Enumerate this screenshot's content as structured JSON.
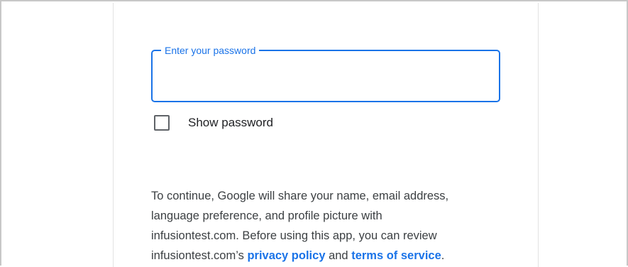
{
  "password_field": {
    "label": "Enter your password",
    "value": ""
  },
  "show_password": {
    "label": "Show password",
    "checked": false
  },
  "disclaimer": {
    "line1": "To continue, Google will share your name, email address,",
    "line2": "language preference, and profile picture with",
    "line3": "infusiontest.com. Before using this app, you can review",
    "line4_prefix": "infusiontest.com’s ",
    "privacy_link": "privacy policy",
    "and_text": " and ",
    "terms_link": "terms of service",
    "line4_suffix": "."
  },
  "colors": {
    "accent": "#1a73e8",
    "text": "#202124",
    "secondary_text": "#3c4043",
    "border": "#c7c7c7"
  }
}
